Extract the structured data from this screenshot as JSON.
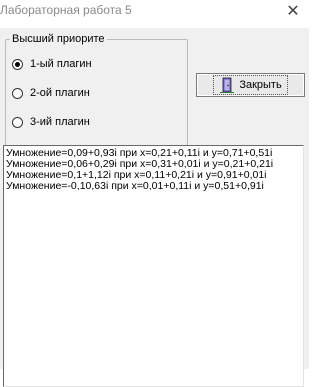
{
  "window": {
    "title": "Лабораторная работа 5",
    "close_glyph": "✕"
  },
  "priority_group": {
    "legend": "Высший приорите",
    "options": [
      {
        "label": "1-ый плагин",
        "checked": true
      },
      {
        "label": "2-ой плагин",
        "checked": false
      },
      {
        "label": "3-ий плагин",
        "checked": false
      }
    ]
  },
  "close_button": {
    "label": "Закрыть",
    "icon": "door-exit-icon"
  },
  "output": {
    "lines": [
      "Умножение=0,09+0,93i при x=0,21+0,11i и y=0,71+0,51i",
      "Умножение=0,06+0,29i при x=0,31+0,01i и y=0,21+0,21i",
      "Умножение=0,1+1,12i при x=0,11+0,21i и y=0,91+0,01i",
      "Умножение=-0,10,63i при x=0,01+0,11i и y=0,51+0,91i"
    ]
  }
}
